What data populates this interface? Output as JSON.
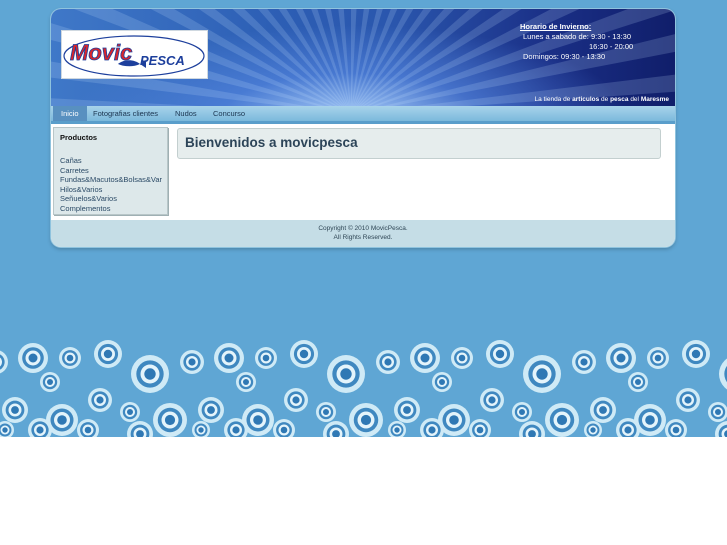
{
  "header": {
    "logo_text": "Movic pesca",
    "hours": {
      "title": "Horario de Invierno:",
      "line1": "Lunes a sabado de: 9:30 - 13:30",
      "line2": "16:30 - 20:00",
      "line3": "Domingos: 09:30 - 13:30"
    },
    "tagline": {
      "part1": "La tienda de ",
      "bold1": "articulos",
      "part2": " de ",
      "bold2": "pesca",
      "part3": " del ",
      "bold3": "Maresme"
    }
  },
  "nav": {
    "items": [
      {
        "label": "Inicio"
      },
      {
        "label": "Fotografias clientes"
      },
      {
        "label": "Nudos"
      },
      {
        "label": "Concurso"
      }
    ]
  },
  "sidebar": {
    "title": "Productos",
    "items": [
      {
        "label": "Cañas"
      },
      {
        "label": "Carretes"
      },
      {
        "label": "Fundas&Macutos&Bolsas&Var"
      },
      {
        "label": "Hilos&Varios"
      },
      {
        "label": "Señuelos&Varios"
      },
      {
        "label": "Complementos"
      }
    ]
  },
  "main": {
    "welcome_title": "Bienvenidos a movicpesca"
  },
  "footer": {
    "line1": "Copyright © 2010 MovicPesca.",
    "line2": "All Rights Reserved."
  },
  "colors": {
    "page_bg": "#5fa6d4",
    "nav_active": "#5890c0",
    "footer_bg": "#c5dde6",
    "logo_red": "#d9262c",
    "logo_blue": "#1d3f9c"
  }
}
